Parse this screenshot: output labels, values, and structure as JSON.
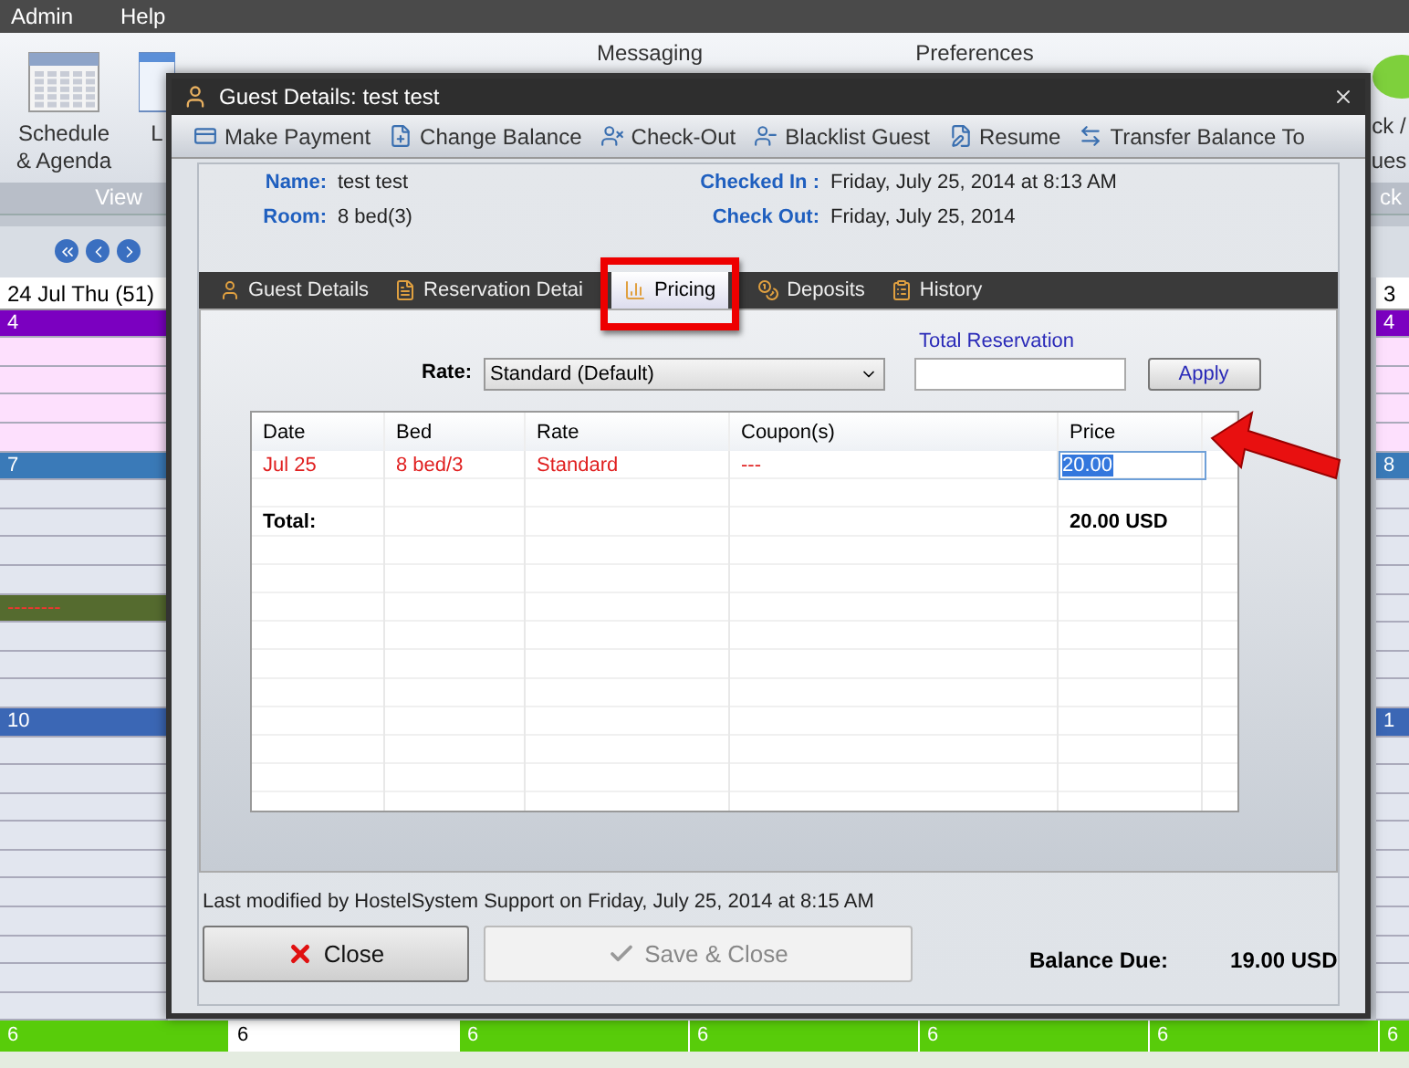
{
  "menu": [
    {
      "label": "Admin"
    },
    {
      "label": "Help"
    }
  ],
  "ribbon": {
    "schedule_label": "Schedule\n& Agenda",
    "partial_label": "L",
    "messaging_label": "Messaging",
    "preferences_label": "Preferences",
    "right_labels": [
      "ck /",
      "ues"
    ],
    "groups": [
      "View",
      "ck"
    ]
  },
  "calendar": {
    "left_header": "24 Jul Thu (51)",
    "right_header": "3",
    "left_rows": [
      {
        "kind": "room",
        "label": "4",
        "color": "#7b00c0"
      },
      {
        "kind": "booked",
        "color": "#fde0fd"
      },
      {
        "kind": "booked",
        "color": "#fde0fd"
      },
      {
        "kind": "booked",
        "color": "#fde0fd"
      },
      {
        "kind": "booked",
        "color": "#fde0fd"
      },
      {
        "kind": "room",
        "label": "7",
        "color": "#3a7ab8"
      },
      {
        "kind": "free"
      },
      {
        "kind": "free"
      },
      {
        "kind": "free"
      },
      {
        "kind": "free"
      },
      {
        "kind": "block",
        "label": "--------",
        "color": "#556b2f"
      },
      {
        "kind": "free"
      },
      {
        "kind": "free"
      },
      {
        "kind": "free"
      },
      {
        "kind": "room",
        "label": "10",
        "color": "#3b67b5"
      },
      {
        "kind": "free"
      },
      {
        "kind": "free"
      },
      {
        "kind": "free"
      },
      {
        "kind": "free"
      },
      {
        "kind": "free"
      },
      {
        "kind": "free"
      },
      {
        "kind": "free"
      },
      {
        "kind": "free"
      },
      {
        "kind": "free"
      },
      {
        "kind": "free"
      }
    ],
    "right_rows": [
      {
        "kind": "room",
        "label": "4",
        "color": "#7b00c0"
      },
      {
        "kind": "booked",
        "color": "#fde0fd"
      },
      {
        "kind": "booked",
        "color": "#fde0fd"
      },
      {
        "kind": "booked",
        "color": "#fde0fd"
      },
      {
        "kind": "booked",
        "color": "#fde0fd"
      },
      {
        "kind": "room",
        "label": "8",
        "color": "#3a7ab8"
      },
      {
        "kind": "free"
      },
      {
        "kind": "free"
      },
      {
        "kind": "free"
      },
      {
        "kind": "free"
      },
      {
        "kind": "free"
      },
      {
        "kind": "free"
      },
      {
        "kind": "free"
      },
      {
        "kind": "free"
      },
      {
        "kind": "room",
        "label": "1",
        "color": "#3b67b5"
      },
      {
        "kind": "free"
      },
      {
        "kind": "free"
      },
      {
        "kind": "free"
      },
      {
        "kind": "free"
      },
      {
        "kind": "free"
      },
      {
        "kind": "free"
      },
      {
        "kind": "free"
      },
      {
        "kind": "free"
      },
      {
        "kind": "free"
      },
      {
        "kind": "free"
      }
    ],
    "bottom_cells": [
      {
        "label": "6",
        "selected": false
      },
      {
        "label": "6",
        "selected": true
      },
      {
        "label": "6",
        "selected": false
      },
      {
        "label": "6",
        "selected": false
      },
      {
        "label": "6",
        "selected": false
      },
      {
        "label": "6",
        "selected": false
      },
      {
        "label": "6",
        "selected": false
      }
    ]
  },
  "dialog": {
    "title": "Guest Details: test test",
    "toolbar": [
      {
        "kind": "payment",
        "label": "Make Payment"
      },
      {
        "kind": "balance",
        "label": "Change Balance"
      },
      {
        "kind": "checkout",
        "label": "Check-Out"
      },
      {
        "kind": "blacklist",
        "label": "Blacklist Guest"
      },
      {
        "kind": "resume",
        "label": "Resume"
      },
      {
        "kind": "transfer",
        "label": "Transfer Balance To"
      }
    ],
    "info_left": [
      {
        "label": "Name:",
        "value": "test test"
      },
      {
        "label": "Room:",
        "value": "8 bed(3)"
      }
    ],
    "info_right": [
      {
        "label": "Checked In :",
        "value": "Friday, July 25, 2014 at 8:13 AM"
      },
      {
        "label": "Check Out:",
        "value": "Friday, July 25, 2014"
      }
    ],
    "tabs": [
      {
        "kind": "guest",
        "label": "Guest Details",
        "selected": false
      },
      {
        "kind": "reservation",
        "label": "Reservation Detai",
        "selected": false
      },
      {
        "kind": "pricing",
        "label": "Pricing",
        "selected": true,
        "highlighted": true
      },
      {
        "kind": "deposits",
        "label": "Deposits",
        "selected": false
      },
      {
        "kind": "history",
        "label": "History",
        "selected": false
      }
    ],
    "rate_label": "Rate:",
    "rate_value": "Standard (Default)",
    "total_reservation_label": "Total Reservation",
    "apply": "Apply",
    "columns": [
      "Date",
      "Bed",
      "Rate",
      "Coupon(s)",
      "Price"
    ],
    "rows": [
      {
        "kind": "entry",
        "date": "Jul 25",
        "bed": "8 bed/3",
        "rate": "Standard",
        "coupon": "---",
        "price": "20.00"
      },
      {
        "kind": "total",
        "label": "Total:",
        "price": "20.00 USD"
      }
    ],
    "last_modified": "Last modified by HostelSystem Support on Friday, July 25, 2014 at 8:15 AM",
    "close": "Close",
    "save_close": {
      "label": "Save & Close",
      "disabled": true
    },
    "balance_label": "Balance Due:",
    "balance_value": "19.00 USD"
  }
}
